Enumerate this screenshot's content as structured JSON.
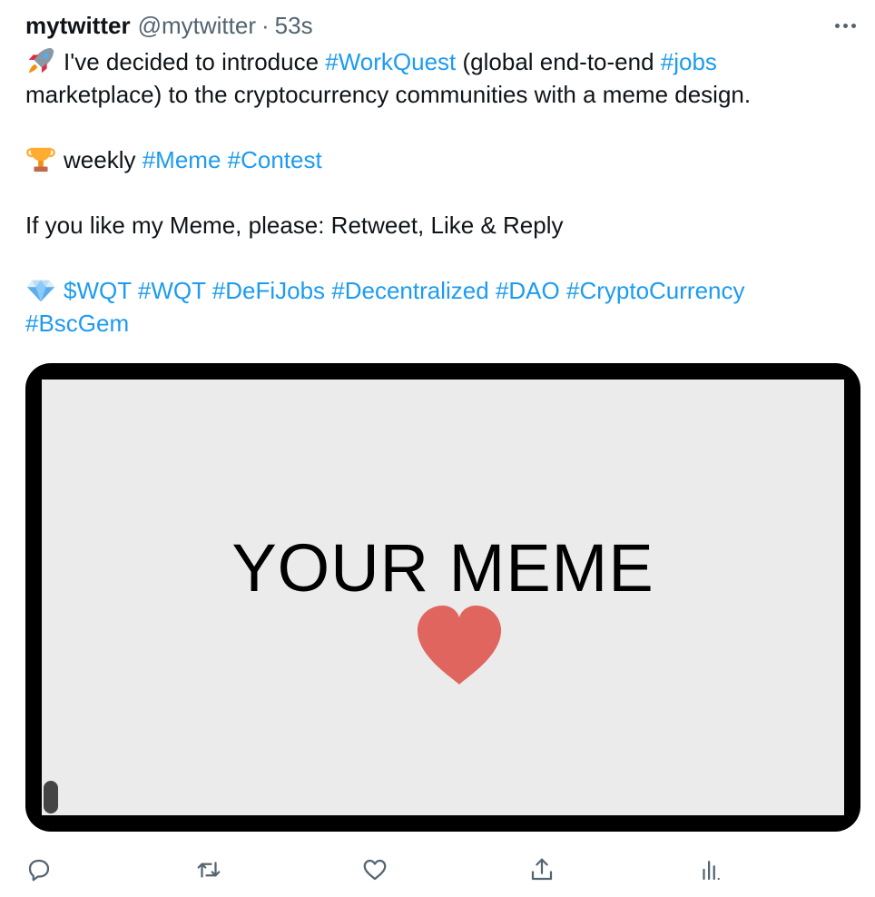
{
  "header": {
    "display_name": "mytwitter",
    "handle": "@mytwitter",
    "separator": "·",
    "timestamp": "53s",
    "more_icon": "ellipsis-icon"
  },
  "tweet": {
    "line1": {
      "emoji": "rocket-icon",
      "pre": "I've decided to introduce ",
      "tag1": "#WorkQuest",
      "mid": " (global end-to-end ",
      "tag2": "#jobs"
    },
    "line2": "marketplace) to the cryptocurrency communities with a meme design.",
    "line3": {
      "emoji": "trophy-icon",
      "pre": "weekly ",
      "tag1": "#Meme",
      "tag2": "#Contest"
    },
    "line4": "If you like my Meme, please: Retweet, Like & Reply",
    "line5": {
      "emoji": "gem-icon",
      "tags": [
        "$WQT",
        "#WQT",
        "#DeFiJobs",
        "#Decentralized",
        "#DAO",
        "#CryptoCurrency"
      ]
    },
    "line6": {
      "tag": "#BscGem"
    }
  },
  "media": {
    "meme_text": "YOUR MEME",
    "heart_icon": "heart-icon",
    "heart_color": "#e0655f"
  },
  "actions": {
    "icons": [
      "reply-icon",
      "retweet-icon",
      "like-icon",
      "share-icon",
      "analytics-icon"
    ]
  },
  "colors": {
    "link": "#1d9bf0",
    "secondary_text": "#536471",
    "icon": "#536471"
  }
}
